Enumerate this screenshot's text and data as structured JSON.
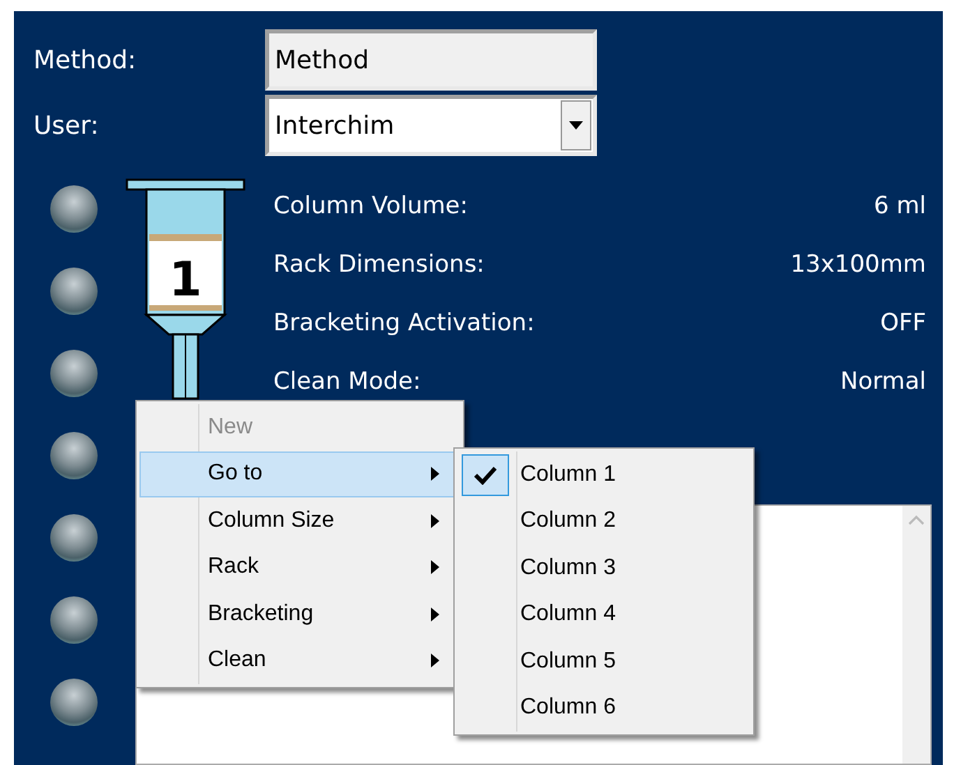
{
  "fields": [
    {
      "label": "Method:",
      "value": "Method",
      "kind": "text"
    },
    {
      "label": "User:",
      "value": "Interchim",
      "kind": "dropdown"
    }
  ],
  "indicators": [
    {
      "on": false
    },
    {
      "on": false
    },
    {
      "on": false
    },
    {
      "on": false
    },
    {
      "on": false
    },
    {
      "on": false
    },
    {
      "on": false
    }
  ],
  "syringe": {
    "number": "1"
  },
  "info": [
    {
      "label": "Column Volume:",
      "value": "6 ml"
    },
    {
      "label": "Rack Dimensions:",
      "value": "13x100mm"
    },
    {
      "label": "Bracketing Activation:",
      "value": "OFF"
    },
    {
      "label": "Clean Mode:",
      "value": "Normal"
    }
  ],
  "context_menu": [
    {
      "label": "New",
      "disabled": true,
      "has_submenu": false,
      "selected": false
    },
    {
      "label": "Go to",
      "disabled": false,
      "has_submenu": true,
      "selected": true
    },
    {
      "label": "Column Size",
      "disabled": false,
      "has_submenu": true,
      "selected": false
    },
    {
      "label": "Rack",
      "disabled": false,
      "has_submenu": true,
      "selected": false
    },
    {
      "label": "Bracketing",
      "disabled": false,
      "has_submenu": true,
      "selected": false
    },
    {
      "label": "Clean",
      "disabled": false,
      "has_submenu": true,
      "selected": false
    }
  ],
  "submenu": [
    {
      "label": "Column 1",
      "checked": true
    },
    {
      "label": "Column 2",
      "checked": false
    },
    {
      "label": "Column 3",
      "checked": false
    },
    {
      "label": "Column 4",
      "checked": false
    },
    {
      "label": "Column 5",
      "checked": false
    },
    {
      "label": "Column 6",
      "checked": false
    }
  ]
}
